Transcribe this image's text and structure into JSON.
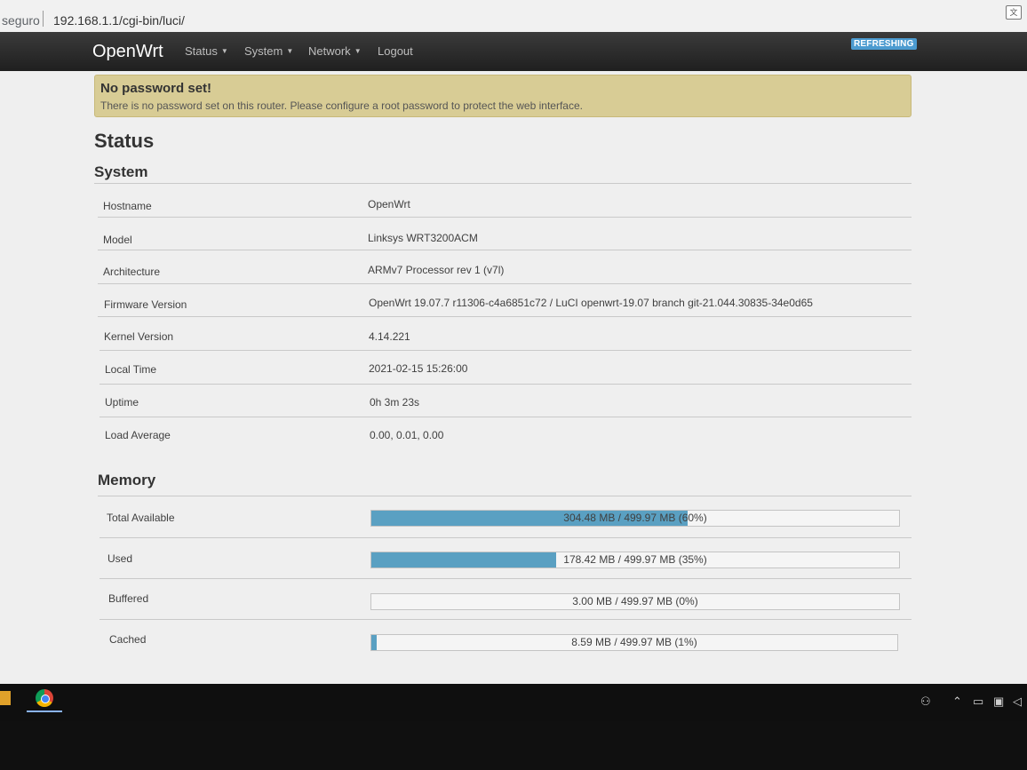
{
  "browser": {
    "security_label": "seguro",
    "url": "192.168.1.1/cgi-bin/luci/"
  },
  "navbar": {
    "brand": "OpenWrt",
    "menu": [
      {
        "label": "Status"
      },
      {
        "label": "System"
      },
      {
        "label": "Network"
      },
      {
        "label": "Logout"
      }
    ],
    "refresh_badge": "REFRESHING"
  },
  "alert": {
    "title": "No password set!",
    "text": "There is no password set on this router. Please configure a root password to protect the web interface."
  },
  "page_title": "Status",
  "system": {
    "heading": "System",
    "rows": [
      {
        "label": "Hostname",
        "value": "OpenWrt"
      },
      {
        "label": "Model",
        "value": "Linksys WRT3200ACM"
      },
      {
        "label": "Architecture",
        "value": "ARMv7 Processor rev 1 (v7l)"
      },
      {
        "label": "Firmware Version",
        "value": "OpenWrt 19.07.7 r11306-c4a6851c72 / LuCI openwrt-19.07 branch git-21.044.30835-34e0d65"
      },
      {
        "label": "Kernel Version",
        "value": "4.14.221"
      },
      {
        "label": "Local Time",
        "value": "2021-02-15 15:26:00"
      },
      {
        "label": "Uptime",
        "value": "0h 3m 23s"
      },
      {
        "label": "Load Average",
        "value": "0.00, 0.01, 0.00"
      }
    ]
  },
  "memory": {
    "heading": "Memory",
    "rows": [
      {
        "label": "Total Available",
        "text": "304.48 MB / 499.97 MB (60%)",
        "fraction": 0.6
      },
      {
        "label": "Used",
        "text": "178.42 MB / 499.97 MB (35%)",
        "fraction": 0.35
      },
      {
        "label": "Buffered",
        "text": "3.00 MB / 499.97 MB (0%)",
        "fraction": 0.0
      },
      {
        "label": "Cached",
        "text": "8.59 MB / 499.97 MB (1%)",
        "fraction": 0.01
      }
    ]
  },
  "colors": {
    "navbar": "#2a2a2a",
    "alert": "#d8cc95",
    "bar_fill": "#5aa0c2",
    "badge": "#4c9bd0"
  }
}
